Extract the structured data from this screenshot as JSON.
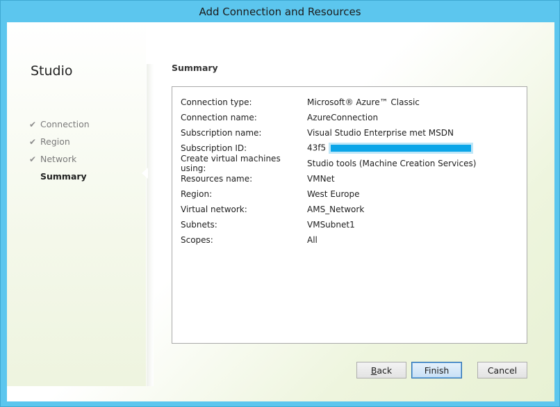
{
  "window": {
    "title": "Add Connection and Resources"
  },
  "sidebar": {
    "title": "Studio",
    "steps": [
      {
        "label": "Connection",
        "done": true
      },
      {
        "label": "Region",
        "done": true
      },
      {
        "label": "Network",
        "done": true
      },
      {
        "label": "Summary",
        "done": false,
        "active": true
      }
    ]
  },
  "summary": {
    "title": "Summary",
    "rows": [
      {
        "label": "Connection type:",
        "value": "Microsoft® Azure™ Classic"
      },
      {
        "label": "Connection name:",
        "value": "AzureConnection"
      },
      {
        "label": "Subscription name:",
        "value": "Visual Studio Enterprise met MSDN"
      },
      {
        "label": "Subscription ID:",
        "value": "43f5"
      },
      {
        "label": "Create virtual machines using:",
        "value": "Studio tools (Machine Creation Services)"
      },
      {
        "label": "Resources name:",
        "value": "VMNet"
      },
      {
        "label": "Region:",
        "value": "West Europe"
      },
      {
        "label": "Virtual network:",
        "value": "AMS_Network"
      },
      {
        "label": "Subnets:",
        "value": "VMSubnet1"
      },
      {
        "label": "Scopes:",
        "value": "All"
      }
    ]
  },
  "buttons": {
    "back_prefix": "B",
    "back_rest": "ack",
    "finish": "Finish",
    "cancel": "Cancel"
  },
  "colors": {
    "redaction": "#0aa5e8",
    "titlebar": "#5cc6ee"
  }
}
